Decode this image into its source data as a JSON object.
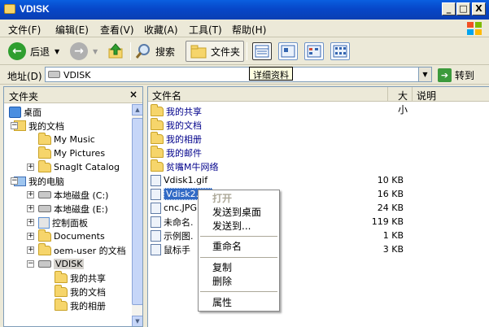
{
  "window": {
    "title": "VDISK",
    "min": "_",
    "max": "□",
    "close": "X"
  },
  "menu": [
    "文件(F)",
    "编辑(E)",
    "查看(V)",
    "收藏(A)",
    "工具(T)",
    "帮助(H)"
  ],
  "toolbar": {
    "back": "后退",
    "search": "搜索",
    "folders": "文件夹",
    "tooltip": "详细资料"
  },
  "address": {
    "label": "地址(D)",
    "value": "VDISK",
    "go": "转到"
  },
  "folder_pane": {
    "title": "文件夹",
    "close": "×",
    "tree": [
      {
        "label": "桌面",
        "icon": "desktop-icon",
        "level": 0,
        "expander": ""
      },
      {
        "label": "我的文档",
        "icon": "documents-icon",
        "level": 1,
        "expander": "−"
      },
      {
        "label": "My Music",
        "icon": "folder-icon",
        "level": 2,
        "expander": ""
      },
      {
        "label": "My Pictures",
        "icon": "folder-icon",
        "level": 2,
        "expander": ""
      },
      {
        "label": "SnagIt Catalog",
        "icon": "folder-icon",
        "level": 2,
        "expander": "+"
      },
      {
        "label": "我的电脑",
        "icon": "computer-icon",
        "level": 1,
        "expander": "−"
      },
      {
        "label": "本地磁盘 (C:)",
        "icon": "drive-icon",
        "level": 2,
        "expander": "+"
      },
      {
        "label": "本地磁盘 (E:)",
        "icon": "drive-icon",
        "level": 2,
        "expander": "+"
      },
      {
        "label": "控制面板",
        "icon": "control-panel-icon",
        "level": 2,
        "expander": "+"
      },
      {
        "label": "Documents",
        "icon": "folder-icon",
        "level": 2,
        "expander": "+"
      },
      {
        "label": "oem-user 的文档",
        "icon": "folder-icon",
        "level": 2,
        "expander": "+"
      },
      {
        "label": "VDISK",
        "icon": "drive-icon",
        "level": 2,
        "expander": "−"
      },
      {
        "label": "我的共享",
        "icon": "folder-icon",
        "level": 3,
        "expander": ""
      },
      {
        "label": "我的文档",
        "icon": "folder-icon",
        "level": 3,
        "expander": ""
      },
      {
        "label": "我的相册",
        "icon": "folder-icon",
        "level": 3,
        "expander": ""
      }
    ]
  },
  "columns": {
    "name": "文件名",
    "size": "大小",
    "desc": "说明"
  },
  "files": [
    {
      "name": "我的共享",
      "type": "folder",
      "size": ""
    },
    {
      "name": "我的文档",
      "type": "folder",
      "size": ""
    },
    {
      "name": "我的相册",
      "type": "folder",
      "size": ""
    },
    {
      "name": "我的邮件",
      "type": "folder",
      "size": ""
    },
    {
      "name": "贫嘴M牛网络",
      "type": "folder",
      "size": ""
    },
    {
      "name": "Vdisk1.gif",
      "type": "file",
      "size": "10 KB"
    },
    {
      "name": "Vdisk2.gif",
      "type": "file",
      "size": "16 KB"
    },
    {
      "name": "cnc.JPG",
      "type": "file",
      "size": "24 KB"
    },
    {
      "name": "未命名.",
      "type": "file",
      "size": "119 KB"
    },
    {
      "name": "示例图.",
      "type": "file",
      "size": "1 KB"
    },
    {
      "name": "鼠标手",
      "type": "file",
      "size": "3 KB"
    }
  ],
  "context_menu": {
    "open": "打开",
    "send_desktop": "发送到桌面",
    "send_to": "发送到...",
    "rename": "重命名",
    "copy": "复制",
    "delete": "删除",
    "properties": "属性"
  }
}
